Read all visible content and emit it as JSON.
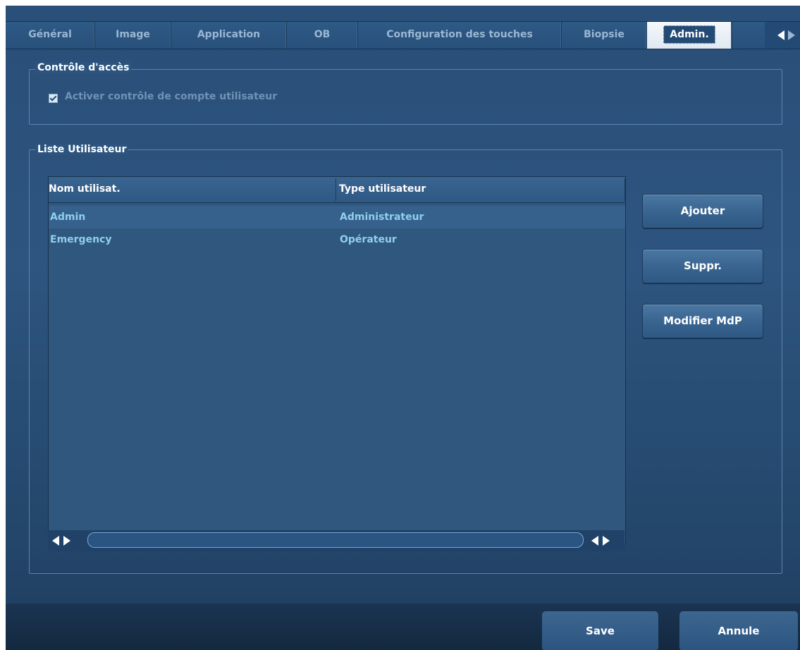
{
  "tabs": [
    {
      "label": "Général",
      "active": false
    },
    {
      "label": "Image",
      "active": false
    },
    {
      "label": "Application",
      "active": false
    },
    {
      "label": "OB",
      "active": false
    },
    {
      "label": "Configuration des touches",
      "active": false
    },
    {
      "label": "Biopsie",
      "active": false
    },
    {
      "label": "Admin.",
      "active": true
    }
  ],
  "access_control": {
    "title": "Contrôle d'accès",
    "enable_label": "Activer contrôle de compte utilisateur",
    "enable_checked": true
  },
  "user_list": {
    "title": "Liste Utilisateur",
    "columns": [
      "Nom utilisat.",
      "Type utilisateur"
    ],
    "rows": [
      {
        "name": "Admin",
        "type": "Administrateur",
        "selected": true
      },
      {
        "name": "Emergency",
        "type": "Opérateur",
        "selected": false
      }
    ],
    "buttons": {
      "add": "Ajouter",
      "delete": "Suppr.",
      "change_password": "Modifier MdP"
    }
  },
  "footer": {
    "save": "Save",
    "cancel": "Annule"
  },
  "icons": {
    "tab_scroll_left": "arrow-left-icon",
    "tab_scroll_right": "arrow-right-icon",
    "checkbox": "checkbox-icon"
  },
  "colors": {
    "background": "#2c547e",
    "text_primary": "#ffffff",
    "text_cell": "#8fd0ec",
    "text_disabled": "#6f93b6"
  }
}
